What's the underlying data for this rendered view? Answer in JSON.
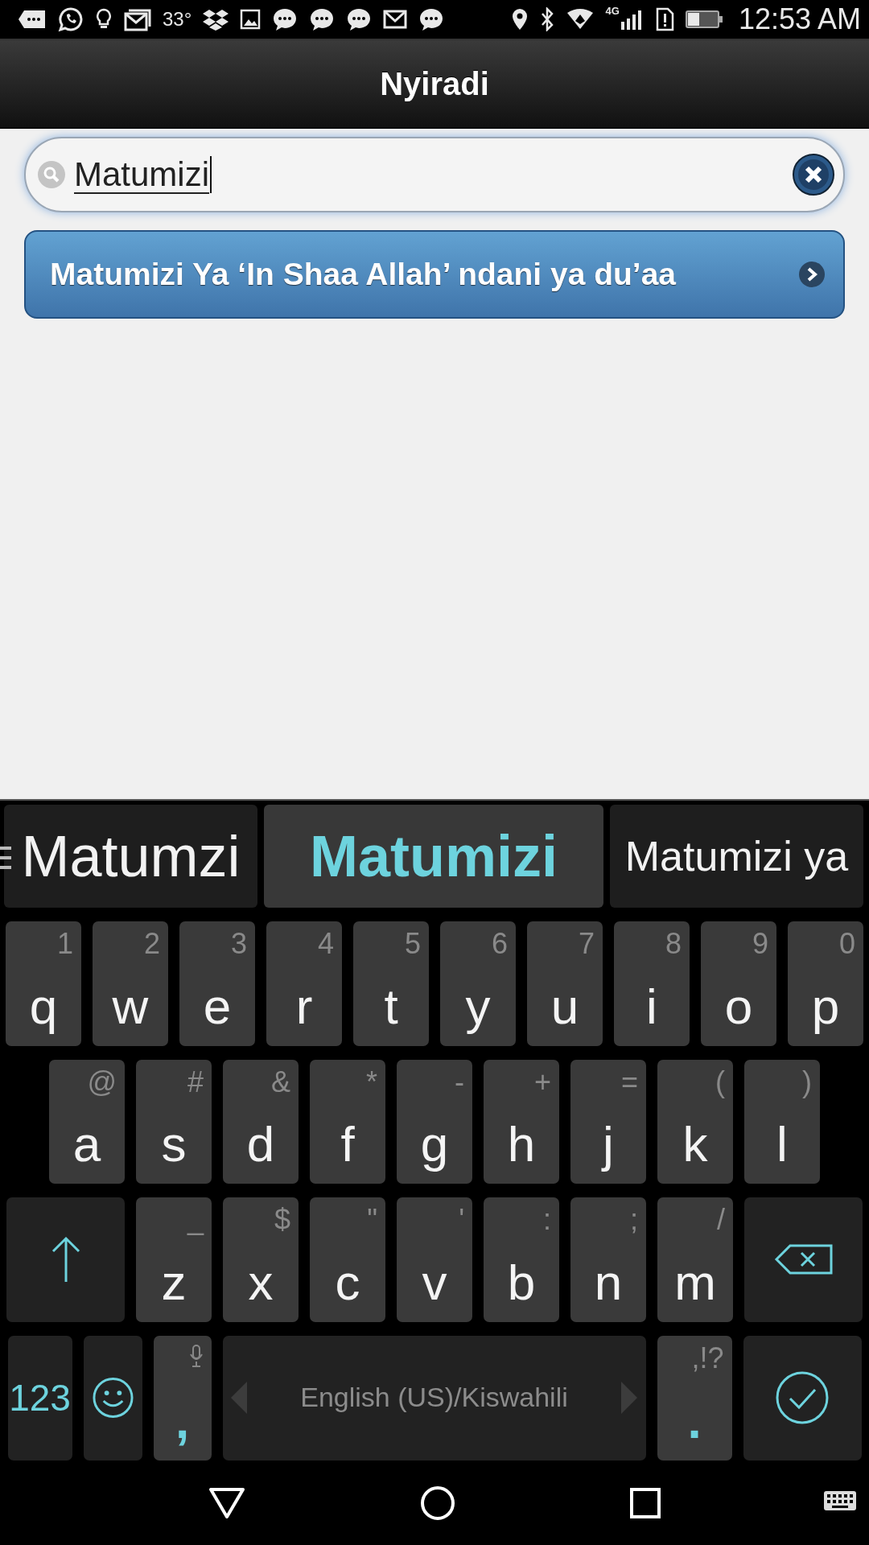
{
  "status_bar": {
    "temperature": "33°",
    "network": "4G",
    "time": "12:53 AM"
  },
  "header": {
    "title": "Nyiradi"
  },
  "search": {
    "value": "Matumizi"
  },
  "results": [
    {
      "label": "Matumizi Ya ‘In Shaa Allah’ ndani ya du’aa"
    }
  ],
  "keyboard": {
    "suggestions": [
      {
        "text": "Matumzi",
        "selected": false
      },
      {
        "text": "Matumizi",
        "selected": true
      },
      {
        "text": "Matumizi ya",
        "selected": false
      }
    ],
    "rows": [
      {
        "keys": [
          {
            "kind": "letter",
            "label": "q",
            "hint": "1"
          },
          {
            "kind": "letter",
            "label": "w",
            "hint": "2"
          },
          {
            "kind": "letter",
            "label": "e",
            "hint": "3"
          },
          {
            "kind": "letter",
            "label": "r",
            "hint": "4"
          },
          {
            "kind": "letter",
            "label": "t",
            "hint": "5"
          },
          {
            "kind": "letter",
            "label": "y",
            "hint": "6"
          },
          {
            "kind": "letter",
            "label": "u",
            "hint": "7"
          },
          {
            "kind": "letter",
            "label": "i",
            "hint": "8"
          },
          {
            "kind": "letter",
            "label": "o",
            "hint": "9"
          },
          {
            "kind": "letter",
            "label": "p",
            "hint": "0"
          }
        ]
      },
      {
        "keys": [
          {
            "kind": "letter",
            "label": "a",
            "hint": "@"
          },
          {
            "kind": "letter",
            "label": "s",
            "hint": "#"
          },
          {
            "kind": "letter",
            "label": "d",
            "hint": "&"
          },
          {
            "kind": "letter",
            "label": "f",
            "hint": "*"
          },
          {
            "kind": "letter",
            "label": "g",
            "hint": "-"
          },
          {
            "kind": "letter",
            "label": "h",
            "hint": "+"
          },
          {
            "kind": "letter",
            "label": "j",
            "hint": "="
          },
          {
            "kind": "letter",
            "label": "k",
            "hint": "("
          },
          {
            "kind": "letter",
            "label": "l",
            "hint": ")"
          }
        ]
      },
      {
        "keys": [
          {
            "kind": "shift"
          },
          {
            "kind": "letter",
            "label": "z",
            "hint": "_"
          },
          {
            "kind": "letter",
            "label": "x",
            "hint": "$"
          },
          {
            "kind": "letter",
            "label": "c",
            "hint": "\""
          },
          {
            "kind": "letter",
            "label": "v",
            "hint": "'"
          },
          {
            "kind": "letter",
            "label": "b",
            "hint": ":"
          },
          {
            "kind": "letter",
            "label": "n",
            "hint": ";"
          },
          {
            "kind": "letter",
            "label": "m",
            "hint": "/"
          },
          {
            "kind": "backspace"
          }
        ]
      },
      {
        "keys": [
          {
            "kind": "symbols",
            "label": "123"
          },
          {
            "kind": "emoji"
          },
          {
            "kind": "comma",
            "label": ","
          },
          {
            "kind": "space",
            "label": "English (US)/Kiswahili"
          },
          {
            "kind": "period",
            "label": ".",
            "hint": ",!?"
          },
          {
            "kind": "enter"
          }
        ]
      }
    ]
  }
}
